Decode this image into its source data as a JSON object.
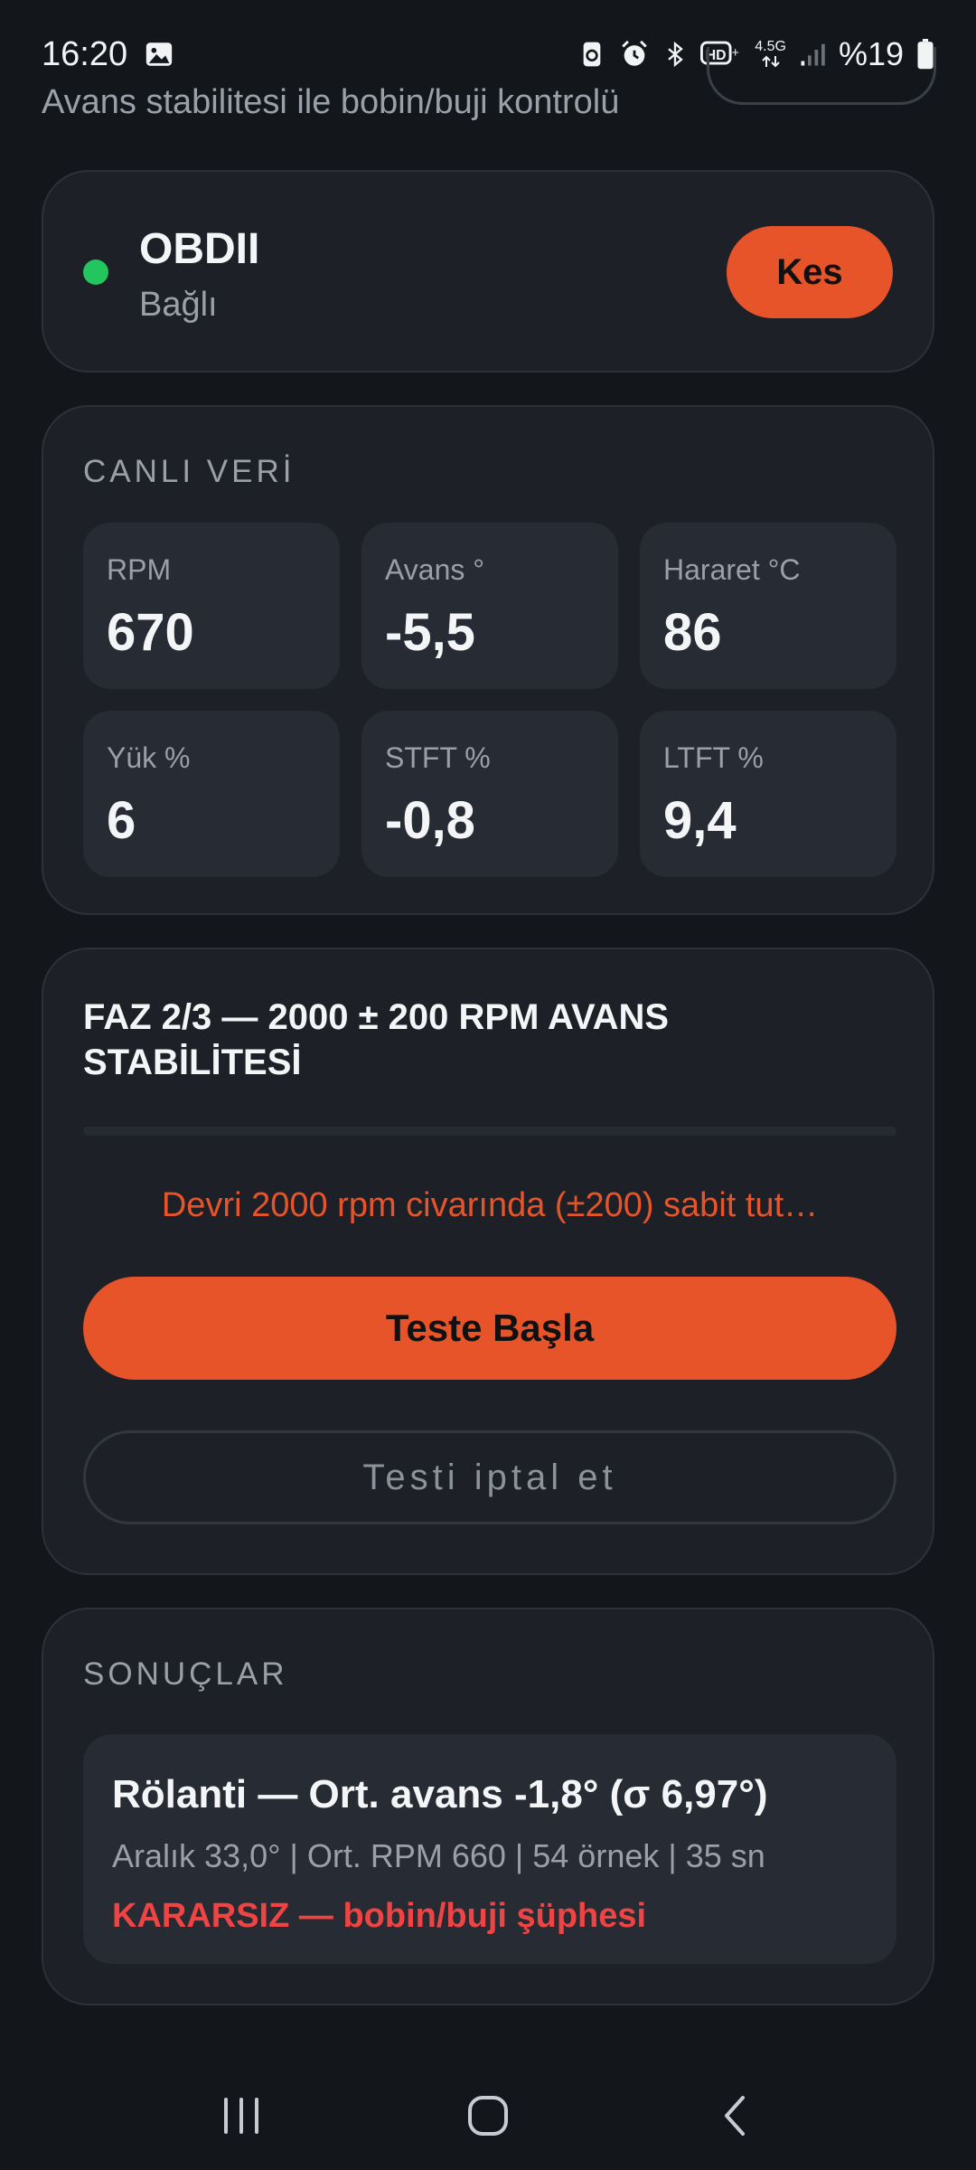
{
  "status_bar": {
    "time": "16:20",
    "network": "4.5G",
    "battery": "%19",
    "icons": [
      "gallery-icon",
      "recycle-icon",
      "alarm-icon",
      "bluetooth-icon",
      "hd-voice-icon",
      "signal-icon",
      "battery-icon"
    ]
  },
  "header": {
    "subtitle": "Avans stabilitesi ile bobin/buji kontrolü"
  },
  "connection": {
    "name": "OBDII",
    "status": "Bağlı",
    "status_color": "#22c55e",
    "disconnect_label": "Kes"
  },
  "live_data": {
    "title": "CANLI VERİ",
    "metrics": [
      {
        "label": "RPM",
        "value": "670"
      },
      {
        "label": "Avans °",
        "value": "-5,5"
      },
      {
        "label": "Hararet °C",
        "value": "86"
      },
      {
        "label": "Yük %",
        "value": "6"
      },
      {
        "label": "STFT %",
        "value": "-0,8"
      },
      {
        "label": "LTFT %",
        "value": "9,4"
      }
    ]
  },
  "phase": {
    "title": "FAZ 2/3 — 2000 ± 200 RPM AVANS STABİLİTESİ",
    "progress": 0,
    "instruction": "Devri 2000 rpm civarında (±200) sabit tut…",
    "start_label": "Teste Başla",
    "cancel_label": "Testi iptal et"
  },
  "results": {
    "title": "SONUÇLAR",
    "items": [
      {
        "title": "Rölanti — Ort. avans -1,8° (σ 6,97°)",
        "detail": "Aralık 33,0° | Ort. RPM 660 | 54 örnek | 35 sn",
        "verdict": "KARARSIZ — bobin/buji şüphesi"
      }
    ]
  },
  "colors": {
    "accent": "#e8542a",
    "danger": "#ef4444",
    "success": "#22c55e",
    "background": "#13161b",
    "card": "#1d2026"
  }
}
